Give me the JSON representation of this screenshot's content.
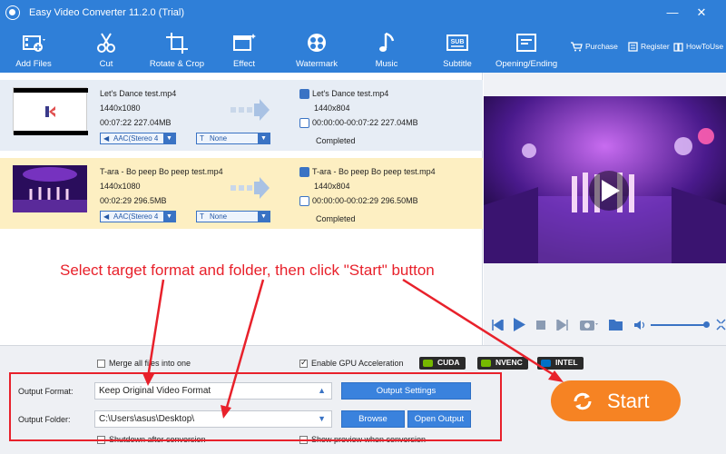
{
  "window": {
    "title": "Easy Video Converter 11.2.0 (Trial)",
    "minimize": "—",
    "close": "✕"
  },
  "toolbar": {
    "add_files": "Add Files",
    "cut": "Cut",
    "rotate_crop": "Rotate & Crop",
    "effect": "Effect",
    "watermark": "Watermark",
    "music": "Music",
    "subtitle": "Subtitle",
    "opening_ending": "Opening/Ending",
    "purchase": "Purchase",
    "register": "Register",
    "how_to_use": "HowToUse"
  },
  "files": [
    {
      "source_name": "Let's Dance test.mp4",
      "source_resolution": "1440x1080",
      "source_info": "00:07:22  227.04MB",
      "audio": "AAC(Stereo 4",
      "subtitle": "None",
      "output_name": "Let's Dance test.mp4",
      "output_resolution": "1440x804",
      "output_info": "00:00:00-00:07:22  227.04MB",
      "status": "Completed"
    },
    {
      "source_name": "T-ara - Bo peep Bo peep test.mp4",
      "source_resolution": "1440x1080",
      "source_info": "00:02:29  296.5MB",
      "audio": "AAC(Stereo 4",
      "subtitle": "None",
      "output_name": "T-ara - Bo peep Bo peep test.mp4",
      "output_resolution": "1440x804",
      "output_info": "00:00:00-00:02:29  296.50MB",
      "status": "Completed"
    }
  ],
  "annotation": "Select target format and folder, then click \"Start\" button",
  "options": {
    "merge_all": "Merge all files into one",
    "gpu_acceleration": "Enable GPU Acceleration",
    "gpu_acceleration_checked": true,
    "gpu_badges": [
      "CUDA",
      "NVENC",
      "INTEL"
    ],
    "shutdown_after": "Shutdown after conversion",
    "show_preview": "Show preview when conversion"
  },
  "output": {
    "format_label": "Output Format:",
    "format_value": "Keep Original Video Format",
    "settings_button": "Output Settings",
    "folder_label": "Output Folder:",
    "folder_value": "C:\\Users\\asus\\Desktop\\",
    "browse_button": "Browse",
    "open_output_button": "Open Output"
  },
  "start_button": "Start",
  "colors": {
    "accent": "#2f7fd8",
    "start": "#f68323",
    "annotation": "#e8212b",
    "selected_row": "#fdefc2",
    "first_row": "#e7edf5"
  }
}
